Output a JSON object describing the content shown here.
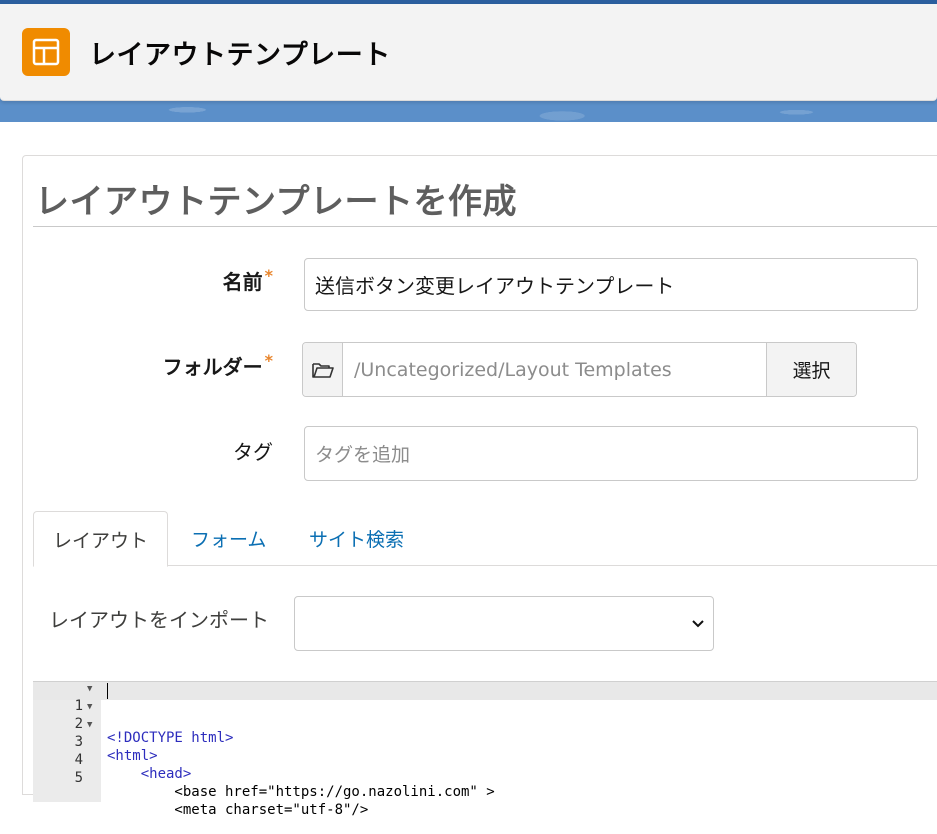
{
  "app": {
    "title": "レイアウトテンプレート",
    "icon": "layout-template-icon",
    "accent": "#f08b00"
  },
  "form": {
    "heading": "レイアウトテンプレートを作成",
    "name_label": "名前",
    "name_value": "送信ボタン変更レイアウトテンプレート",
    "folder_label": "フォルダー",
    "folder_value": "/Uncategorized/Layout Templates",
    "folder_select_button": "選択",
    "tags_label": "タグ",
    "tags_placeholder": "タグを追加",
    "required_marker": "*"
  },
  "tabs": [
    {
      "label": "レイアウト",
      "active": true
    },
    {
      "label": "フォーム",
      "active": false
    },
    {
      "label": "サイト検索",
      "active": false
    }
  ],
  "import": {
    "label": "レイアウトをインポート",
    "selected": ""
  },
  "editor": {
    "lines": [
      {
        "num": "1",
        "fold": "▼",
        "text": "<!DOCTYPE html>"
      },
      {
        "num": "2",
        "fold": "▼",
        "text": "<html>"
      },
      {
        "num": "3",
        "fold": "▼",
        "text": "    <head>"
      },
      {
        "num": "4",
        "fold": "",
        "text": "        <base href=\"https://go.nazolini.com\" >"
      },
      {
        "num": "5",
        "fold": "",
        "text": "        <meta charset=\"utf-8\"/>"
      }
    ]
  }
}
